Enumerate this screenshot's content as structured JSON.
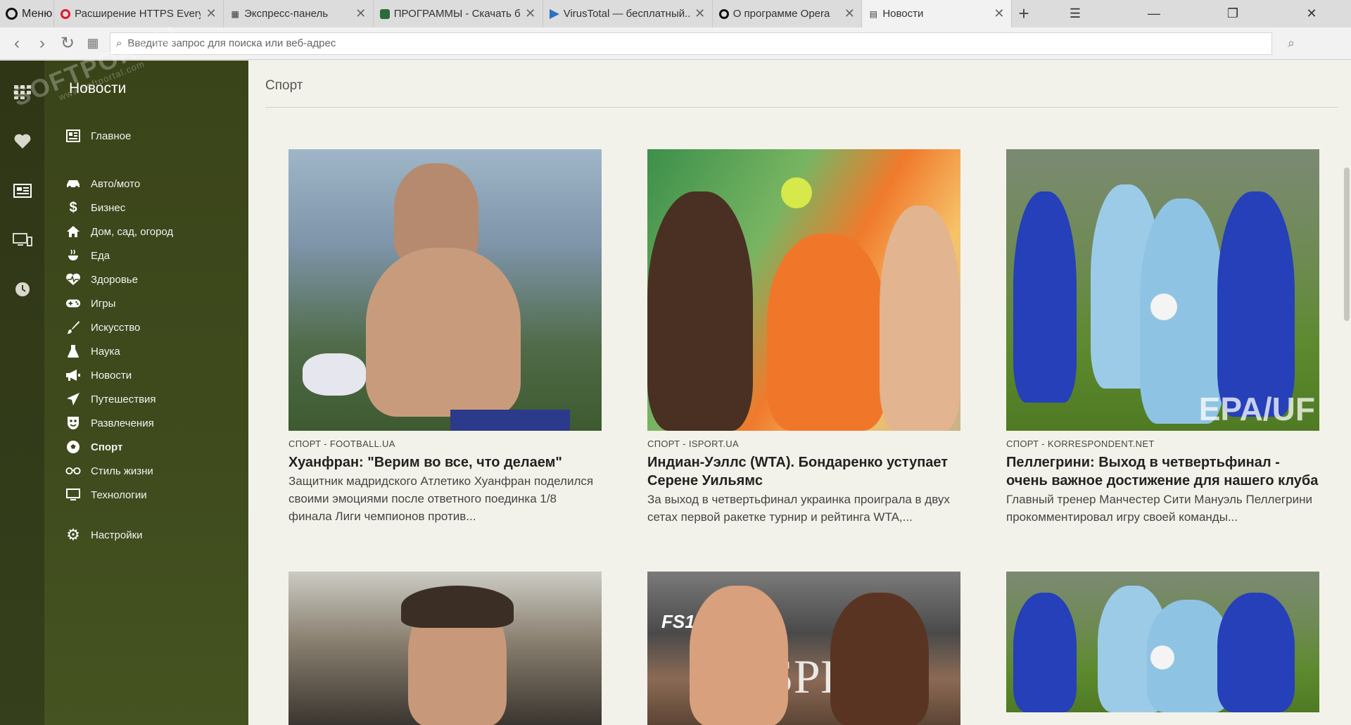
{
  "browser": {
    "menu_label": "Меню",
    "tabs": [
      {
        "title": "Расширение HTTPS Every..."
      },
      {
        "title": "Экспресс-панель"
      },
      {
        "title": "ПРОГРАММЫ - Скачать б..."
      },
      {
        "title": "VirusTotal — бесплатный..."
      },
      {
        "title": "О программе Opera"
      },
      {
        "title": "Новости"
      }
    ],
    "address_placeholder": "Введите запрос для поиска или веб-адрес"
  },
  "watermark": {
    "brand": "SOFTPORTAL",
    "url": "www.softportal.com"
  },
  "sidebar": {
    "title": "Новости",
    "items": [
      {
        "label": "Главное",
        "icon": "newspaper-icon"
      },
      {
        "label": "Авто/мото",
        "icon": "car-icon"
      },
      {
        "label": "Бизнес",
        "icon": "dollar-icon"
      },
      {
        "label": "Дом, сад, огород",
        "icon": "home-icon"
      },
      {
        "label": "Еда",
        "icon": "food-icon"
      },
      {
        "label": "Здоровье",
        "icon": "heartbeat-icon"
      },
      {
        "label": "Игры",
        "icon": "gamepad-icon"
      },
      {
        "label": "Искусство",
        "icon": "brush-icon"
      },
      {
        "label": "Наука",
        "icon": "flask-icon"
      },
      {
        "label": "Новости",
        "icon": "megaphone-icon"
      },
      {
        "label": "Путешествия",
        "icon": "plane-icon"
      },
      {
        "label": "Развлечения",
        "icon": "mask-icon"
      },
      {
        "label": "Спорт",
        "icon": "soccer-ball-icon",
        "active": true
      },
      {
        "label": "Стиль жизни",
        "icon": "glasses-icon"
      },
      {
        "label": "Технологии",
        "icon": "monitor-icon"
      },
      {
        "label": "Настройки",
        "icon": "gear-icon"
      }
    ]
  },
  "main": {
    "section_title": "Спорт",
    "cards": [
      {
        "source": "СПОРТ - FOOTBALL.UA",
        "headline": "Хуанфран: \"Верим во все, что делаем\"",
        "snippet": "Защитник мадридского Атлетико Хуанфран поделился своими эмоциями после ответного поединка 1/8 финала Лиги чемпионов против..."
      },
      {
        "source": "СПОРТ - ISPORT.UA",
        "headline": "Индиан-Уэллс (WTA). Бондаренко уступает Серене Уильямс",
        "snippet": "За выход в четвертьфинал украинка проиграла в двух сетах первой ракетке турнир и рейтинга WTA,..."
      },
      {
        "source": "СПОРТ - KORRESPONDENT.NET",
        "headline": "Пеллегрини: Выход в четвертьфинал - очень важное достижение для нашего клуба",
        "snippet": "Главный тренер Манчестер Сити Мануэль Пеллегрини прокомментировал игру своей команды..."
      }
    ],
    "image_texts": {
      "epa": "EPA/UF",
      "fs1": "FS1",
      "spinks": "SPINKS"
    }
  }
}
